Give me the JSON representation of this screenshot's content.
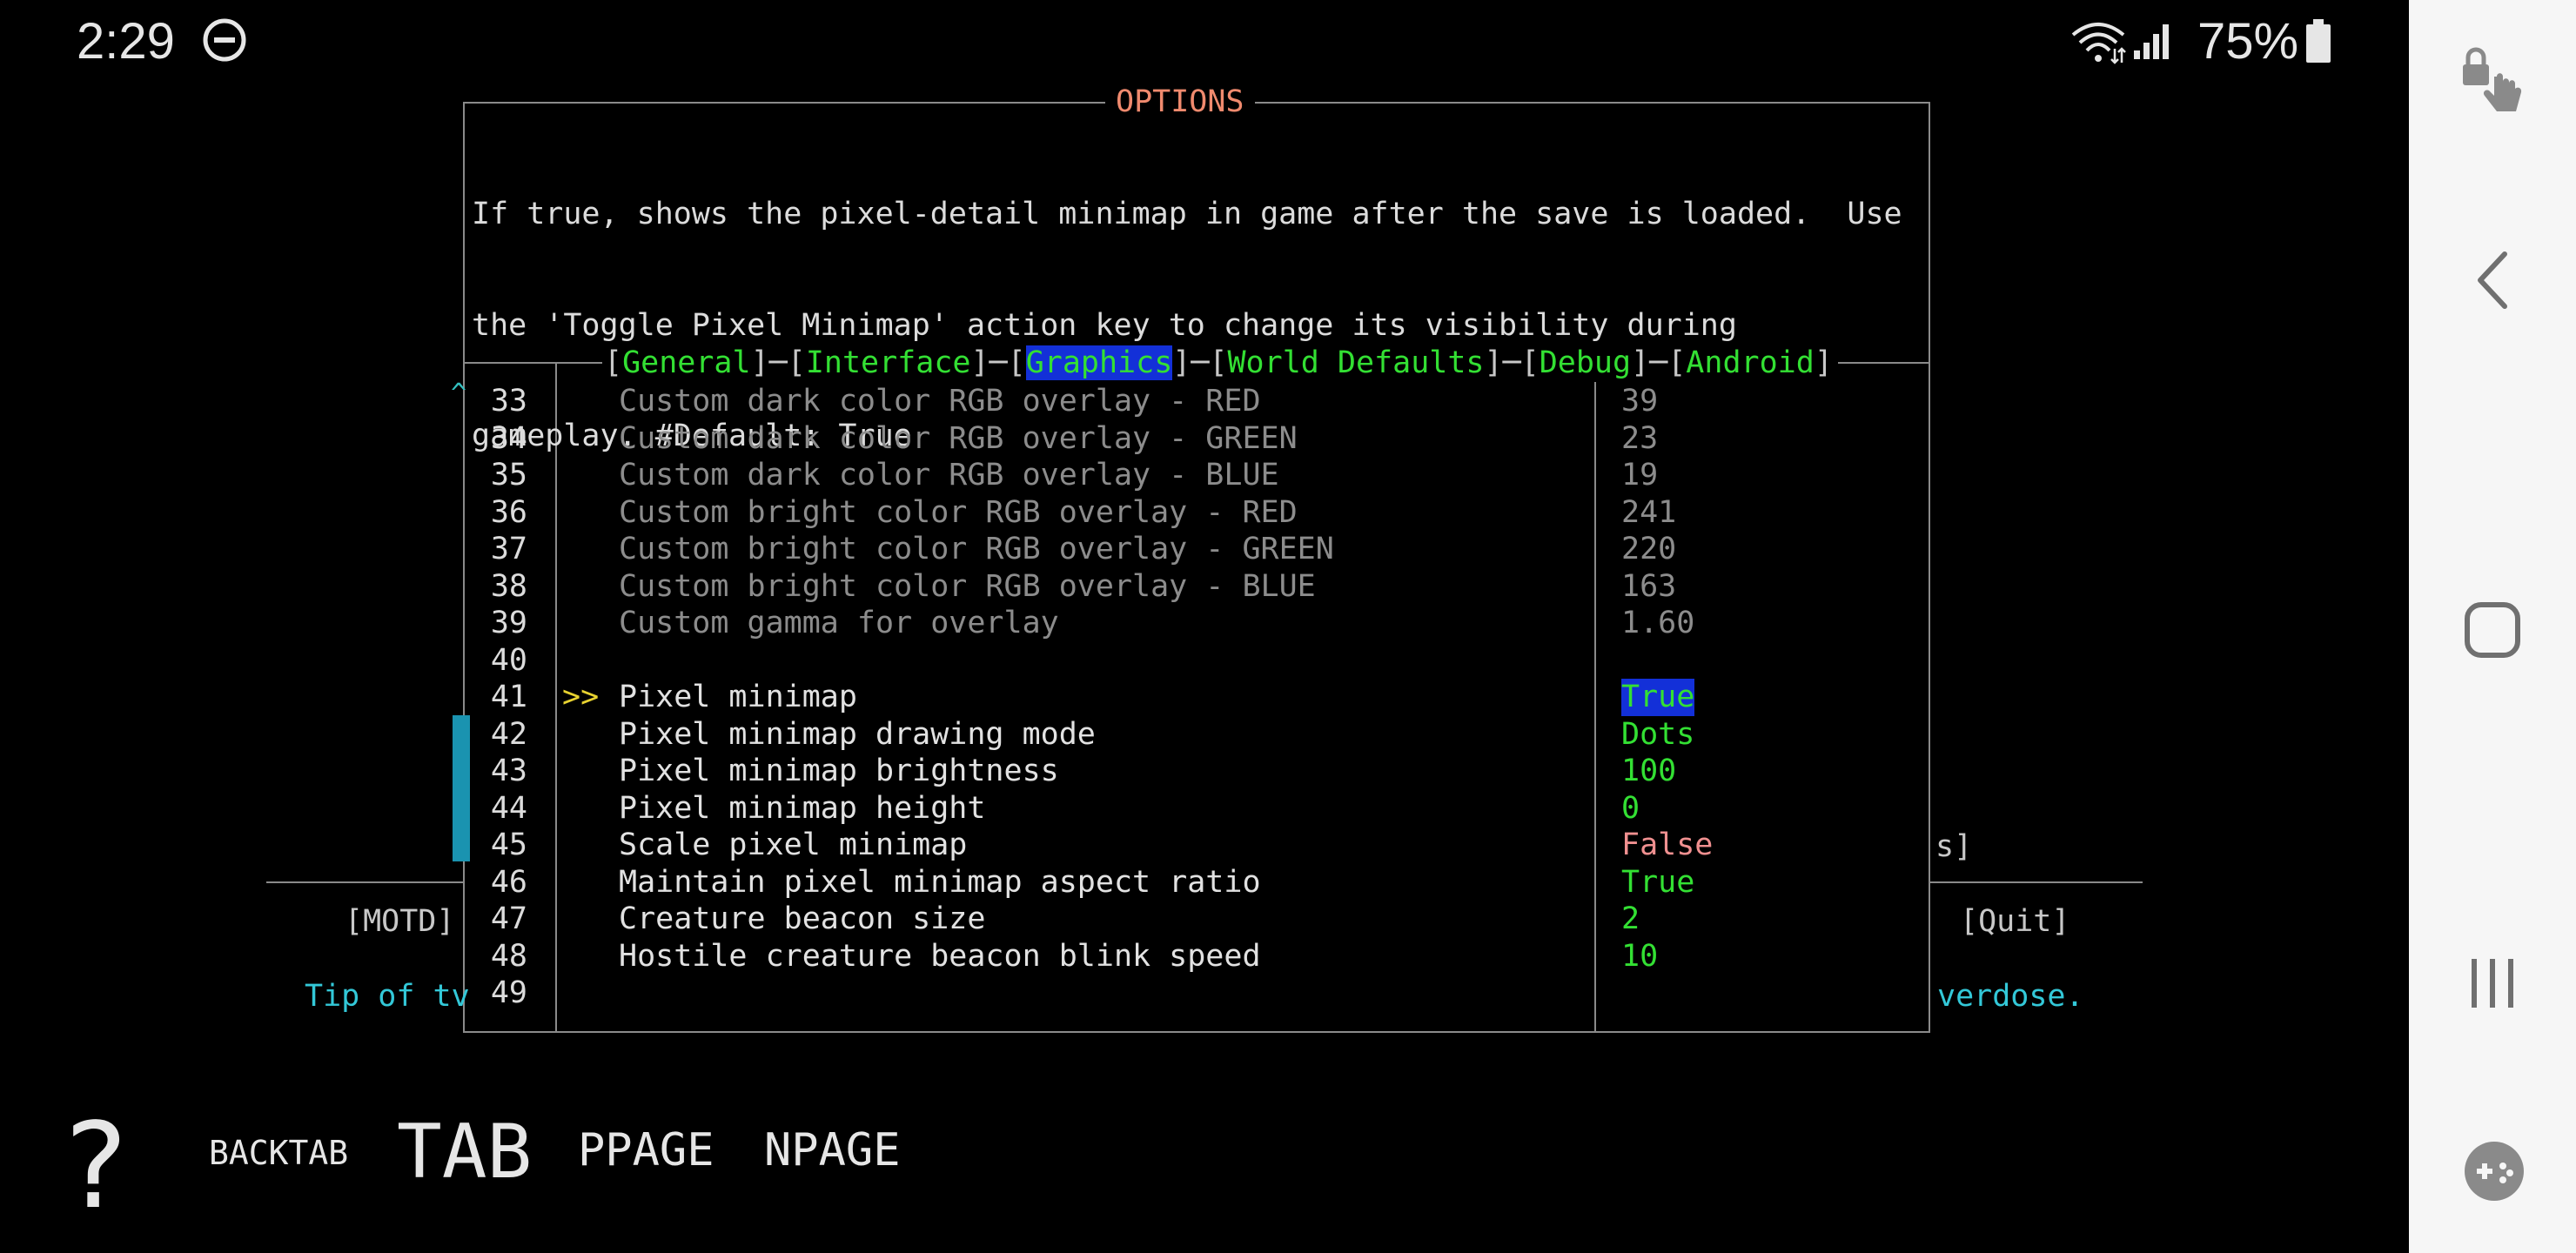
{
  "status_bar": {
    "time": "2:29",
    "battery_percent": "75%",
    "icons": [
      "do-not-disturb-icon",
      "wifi-icon",
      "signal-icon",
      "battery-icon"
    ]
  },
  "options": {
    "title": "OPTIONS",
    "description_lines": [
      "If true, shows the pixel-detail minimap in game after the save is loaded.  Use",
      "the 'Toggle Pixel Minimap' action key to change its visibility during",
      "gameplay. #Default: True"
    ],
    "tabs": [
      "General",
      "Interface",
      "Graphics",
      "World Defaults",
      "Debug",
      "Android"
    ],
    "active_tab": "Graphics",
    "scroll_up_indicator": "^",
    "cursor": ">>",
    "rows": [
      {
        "num": "33",
        "label": "Custom dark color RGB overlay - RED",
        "value": "39"
      },
      {
        "num": "34",
        "label": "Custom dark color RGB overlay - GREEN",
        "value": "23"
      },
      {
        "num": "35",
        "label": "Custom dark color RGB overlay - BLUE",
        "value": "19"
      },
      {
        "num": "36",
        "label": "Custom bright color RGB overlay - RED",
        "value": "241"
      },
      {
        "num": "37",
        "label": "Custom bright color RGB overlay - GREEN",
        "value": "220"
      },
      {
        "num": "38",
        "label": "Custom bright color RGB overlay - BLUE",
        "value": "163"
      },
      {
        "num": "39",
        "label": "Custom gamma for overlay",
        "value": "1.60"
      },
      {
        "num": "40",
        "label": "",
        "value": ""
      },
      {
        "num": "41",
        "label": "Pixel minimap",
        "value": "True"
      },
      {
        "num": "42",
        "label": "Pixel minimap drawing mode",
        "value": "Dots"
      },
      {
        "num": "43",
        "label": "Pixel minimap brightness",
        "value": "100"
      },
      {
        "num": "44",
        "label": "Pixel minimap height",
        "value": "0"
      },
      {
        "num": "45",
        "label": "Scale pixel minimap",
        "value": "False"
      },
      {
        "num": "46",
        "label": "Maintain pixel minimap aspect ratio",
        "value": "True"
      },
      {
        "num": "47",
        "label": "Creature beacon size",
        "value": "2"
      },
      {
        "num": "48",
        "label": "Hostile creature beacon blink speed",
        "value": "10"
      },
      {
        "num": "49",
        "label": "",
        "value": ""
      }
    ]
  },
  "background": {
    "motd": "[MOTD]",
    "quit": "[Quit]",
    "fragment_s": "s]",
    "tip_fragment": "Tip of tv",
    "tip_end_fragment": "verdose."
  },
  "keybar": {
    "help": "?",
    "backtab": "BACKTAB",
    "tab": "TAB",
    "ppage": "PPAGE",
    "npage": "NPAGE"
  },
  "nav": {
    "icons": [
      "lock-touch-icon",
      "back-icon",
      "home-icon",
      "recents-icon",
      "gamepad-icon"
    ]
  },
  "colors": {
    "background": "#000000",
    "title": "#f08a6e",
    "enabled_value": "#33e033",
    "false_value": "#f09090",
    "selection": "#1330d8",
    "scrollbar": "#1a93b0",
    "cursor": "#e8d230",
    "tip": "#33c8d8",
    "nav_bar": "#f6f6f6"
  }
}
